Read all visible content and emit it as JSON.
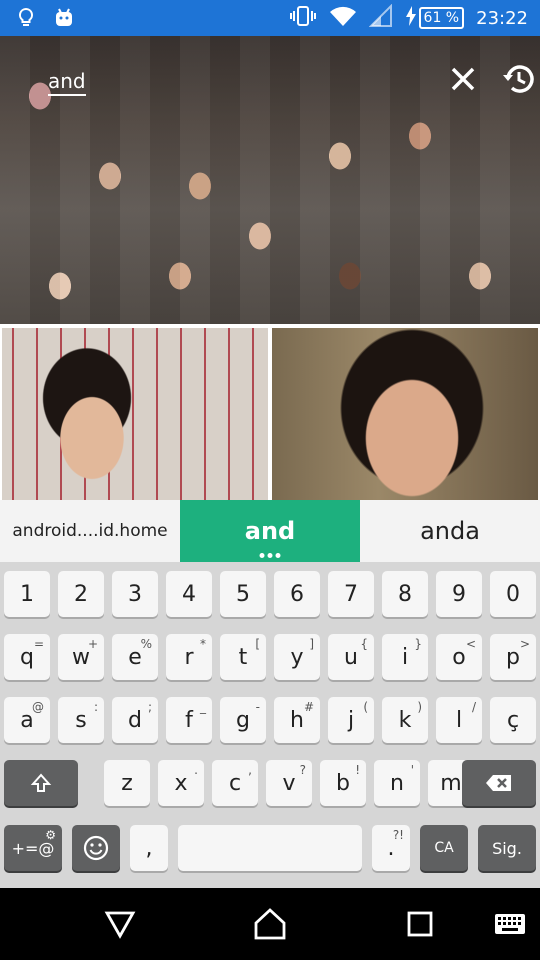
{
  "status_bar": {
    "battery_percent": "61 %",
    "time": "23:22"
  },
  "search": {
    "query": "and"
  },
  "suggestions": [
    "android....id.home",
    "and",
    "anda"
  ],
  "keyboard": {
    "row_numbers": [
      "1",
      "2",
      "3",
      "4",
      "5",
      "6",
      "7",
      "8",
      "9",
      "0"
    ],
    "row1": [
      {
        "key": "q",
        "hint": "="
      },
      {
        "key": "w",
        "hint": "+"
      },
      {
        "key": "e",
        "hint": "%"
      },
      {
        "key": "r",
        "hint": "*"
      },
      {
        "key": "t",
        "hint": "["
      },
      {
        "key": "y",
        "hint": "]"
      },
      {
        "key": "u",
        "hint": "{"
      },
      {
        "key": "i",
        "hint": "}"
      },
      {
        "key": "o",
        "hint": "<"
      },
      {
        "key": "p",
        "hint": ">"
      }
    ],
    "row2": [
      {
        "key": "a",
        "hint": "@"
      },
      {
        "key": "s",
        "hint": ":"
      },
      {
        "key": "d",
        "hint": ";"
      },
      {
        "key": "f",
        "hint": "_"
      },
      {
        "key": "g",
        "hint": "-"
      },
      {
        "key": "h",
        "hint": "#"
      },
      {
        "key": "j",
        "hint": "("
      },
      {
        "key": "k",
        "hint": ")"
      },
      {
        "key": "l",
        "hint": "/"
      },
      {
        "key": "ç",
        "hint": ""
      }
    ],
    "row3": [
      {
        "key": "z",
        "hint": ""
      },
      {
        "key": "x",
        "hint": "."
      },
      {
        "key": "c",
        "hint": ","
      },
      {
        "key": "v",
        "hint": "?"
      },
      {
        "key": "b",
        "hint": "!"
      },
      {
        "key": "n",
        "hint": "'"
      },
      {
        "key": "m",
        "hint": "\""
      }
    ],
    "symbols_label": "+=@",
    "comma_label": ",",
    "period_label": ".",
    "period_hint": "?!",
    "language_label": "CA",
    "enter_label": "Sig."
  }
}
